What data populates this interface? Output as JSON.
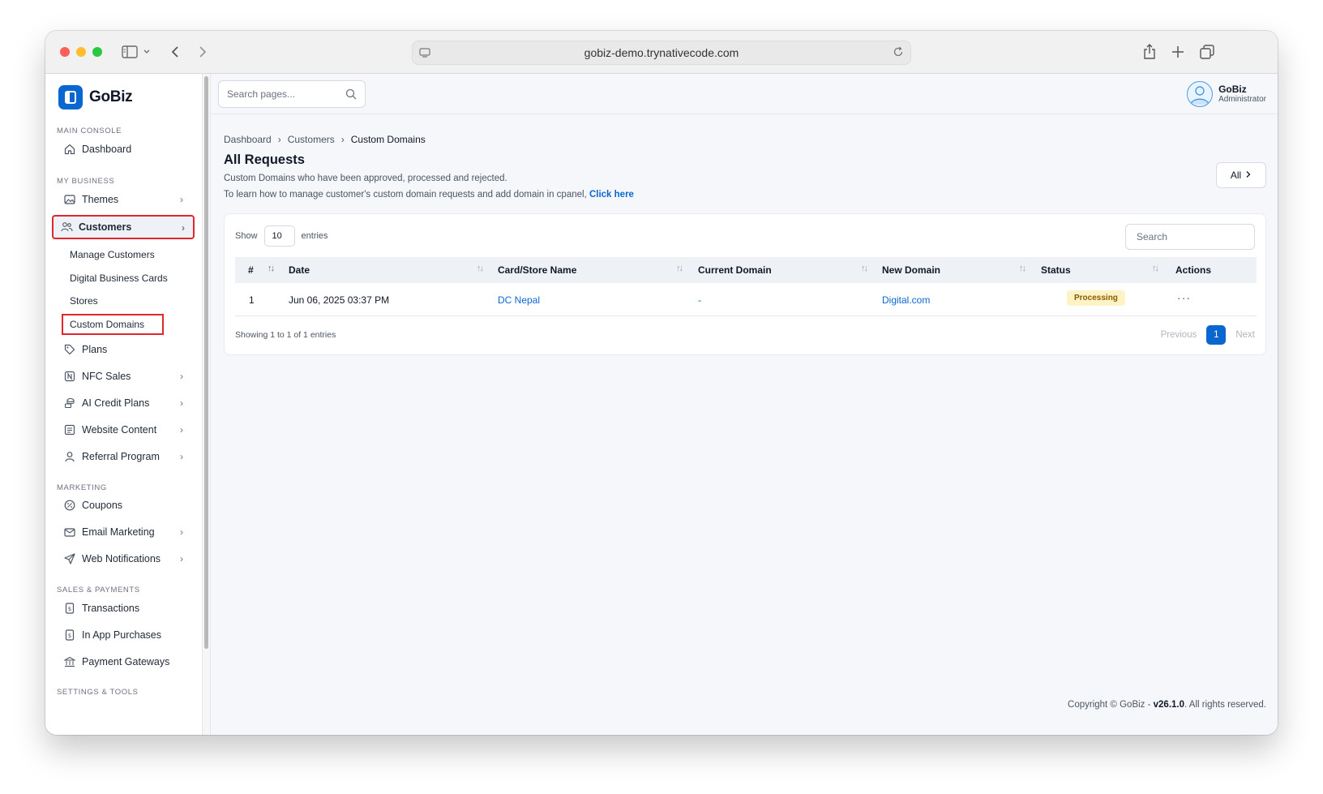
{
  "browser": {
    "url": "gobiz-demo.trynativecode.com",
    "colors": {
      "close": "#ff5f57",
      "minimize": "#febc2e",
      "maximize": "#28c840"
    }
  },
  "brand": {
    "name": "GoBiz",
    "accent": "#0b67d0"
  },
  "sidebar": {
    "sections": {
      "main_console": "MAIN CONSOLE",
      "my_business": "MY BUSINESS",
      "marketing": "MARKETING",
      "sales_payments": "SALES & PAYMENTS",
      "settings_tools": "SETTINGS & TOOLS"
    },
    "items": {
      "dashboard": "Dashboard",
      "themes": "Themes",
      "customers": "Customers",
      "plans": "Plans",
      "nfc_sales": "NFC Sales",
      "ai_credit_plans": "AI Credit Plans",
      "website_content": "Website Content",
      "referral_program": "Referral Program",
      "coupons": "Coupons",
      "email_marketing": "Email Marketing",
      "web_notifications": "Web Notifications",
      "transactions": "Transactions",
      "in_app_purchases": "In App Purchases",
      "payment_gateways": "Payment Gateways"
    },
    "customers_sub": {
      "manage_customers": "Manage Customers",
      "digital_business_cards": "Digital Business Cards",
      "stores": "Stores",
      "custom_domains": "Custom Domains"
    }
  },
  "topbar": {
    "search_placeholder": "Search pages...",
    "user_name": "GoBiz",
    "user_role": "Administrator"
  },
  "breadcrumb": {
    "items": [
      "Dashboard",
      "Customers",
      "Custom Domains"
    ],
    "separator": "›"
  },
  "page": {
    "title": "All Requests",
    "description": "Custom Domains who have been approved, processed and rejected.",
    "help_text": "To learn how to manage customer's custom domain requests and add domain in cpanel,",
    "help_link": "Click here",
    "filter_button": "All"
  },
  "table": {
    "show_label": "Show",
    "page_size": "10",
    "entries_label": "entries",
    "search_placeholder": "Search",
    "columns": [
      "#",
      "Date",
      "Card/Store Name",
      "Current Domain",
      "New Domain",
      "Status",
      "Actions"
    ],
    "rows": [
      {
        "index": "1",
        "date": "Jun 06, 2025 03:37 PM",
        "card_store_name": "DC Nepal",
        "current_domain": "-",
        "new_domain": "Digital.com",
        "status": "Processing",
        "actions": "···"
      }
    ],
    "info": "Showing 1 to 1 of 1 entries",
    "pagination": {
      "previous": "Previous",
      "current_page": "1",
      "next": "Next"
    }
  },
  "footer": {
    "prefix": "Copyright © GoBiz -",
    "version": "v26.1.0",
    "suffix": ". All rights reserved."
  }
}
